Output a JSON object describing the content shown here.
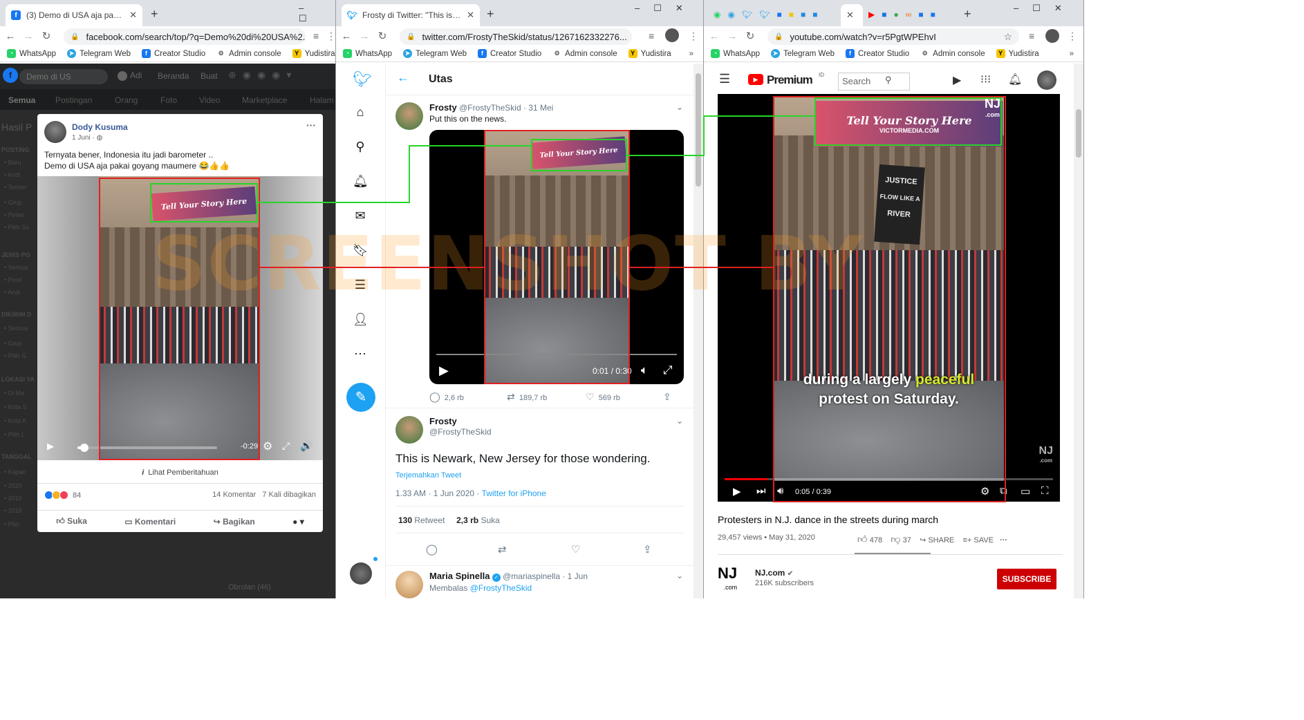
{
  "windows": {
    "facebook": {
      "tab_title": "(3) Demo di USA aja pakai goyan",
      "url": "facebook.com/search/top/?q=Demo%20di%20USA%2...",
      "search_placeholder": "Demo di US",
      "nav_items": [
        "Adi",
        "Beranda",
        "Buat"
      ],
      "filters": [
        "Semua",
        "Postingan",
        "Orang",
        "Foto",
        "Video",
        "Marketplace",
        "Halam"
      ],
      "sidebar_labels": [
        "Hasil P",
        "POSTING",
        "JENIS PO",
        "DIKIRIM D",
        "LOKASI YA",
        "TANGGAL"
      ],
      "sidebar_items": [
        "Baru",
        "Andi",
        "Temen",
        "Grup",
        "Pelan",
        "Pilih Su",
        "Semua",
        "Posti",
        "Andi",
        "Semua",
        "Grup ",
        "Pilih G",
        "Di Ma",
        "Kota S",
        "Kota K",
        "Pilih L",
        "Kapan",
        "2020",
        "2019",
        "2018",
        "Pilih "
      ],
      "post": {
        "author": "Dody Kusuma",
        "date": "1 Juni",
        "text_line1": "Ternyata bener, Indonesia itu jadi barometer ..",
        "text_line2": "Demo di USA aja pakai goyang maumere 😂👍👍",
        "sign_text": "Tell Your Story Here",
        "time_remaining": "-0:29",
        "notice": "Lihat Pemberitahuan",
        "reaction_count": "84",
        "comments": "14 Komentar",
        "shares": "7 Kali dibagikan",
        "like": "Suka",
        "comment": "Komentari",
        "share": "Bagikan"
      },
      "chat_label": "Obrolan (46)",
      "progress": 0.05
    },
    "twitter": {
      "tab_title": "Frosty di Twitter: \"This is Newark,",
      "url": "twitter.com/FrostyTheSkid/status/1267162332276...",
      "header": "Utas",
      "tweet1": {
        "name": "Frosty",
        "handle": "@FrostyTheSkid",
        "date": "· 31 Mei",
        "text": "Put this on the news.",
        "sign_text": "Tell Your Story Here",
        "time": "0:01 / 0:30",
        "replies": "2,6 rb",
        "retweets": "189,7 rb",
        "likes": "569 rb"
      },
      "tweet2": {
        "name": "Frosty",
        "handle": "@FrostyTheSkid",
        "text": "This is Newark, New Jersey for those wondering.",
        "translate": "Terjemahkan Tweet",
        "time": "1.33 AM · 1 Jun 2020 · ",
        "client": "Twitter for iPhone",
        "retweet_count": "130",
        "retweet_label": "Retweet",
        "like_count": "2,3 rb",
        "like_label": "Suka"
      },
      "tweet3": {
        "name": "Maria Spinella",
        "handle": "@mariaspinella",
        "date": "· 1 Jun",
        "reply_prefix": "Membalas ",
        "reply_to": "@FrostyTheSkid"
      }
    },
    "youtube": {
      "url": "youtube.com/watch?v=r5PgtWPEhvI",
      "brand": "Premium",
      "region": "ID",
      "search_placeholder": "Search",
      "sign_text": "VICTORMEDIA.COM",
      "sign_top": "Tell Your Story Here",
      "protest_sign_line1": "JUSTICE",
      "protest_sign_line2": "FLOW LIKE A",
      "protest_sign_line3": "RIVER",
      "caption_part1": "during a largely ",
      "caption_highlight": "peaceful",
      "caption_line2": "protest on Saturday.",
      "logo": "NJ",
      "logo_sub": ".com",
      "time": "0:05 / 0:39",
      "progress": 0.13,
      "title": "Protesters in N.J. dance in the streets during march",
      "views": "29,457 views • May 31, 2020",
      "likes": "478",
      "dislikes": "37",
      "share": "SHARE",
      "save": "SAVE",
      "channel": "NJ.com",
      "subscribers": "216K subscribers",
      "subscribe": "SUBSCRIBE"
    }
  },
  "bookmarks": [
    "WhatsApp",
    "Telegram Web",
    "Creator Studio",
    "Admin console",
    "Yudistira"
  ],
  "watermark": "SCREENSHOT BY",
  "colors": {
    "highlight_red": "#e02020",
    "highlight_green": "#27d427",
    "twitter_blue": "#1da1f2",
    "youtube_red": "#ff0000",
    "facebook_blue": "#1877f2",
    "caption_yellow": "#d4e82a"
  }
}
